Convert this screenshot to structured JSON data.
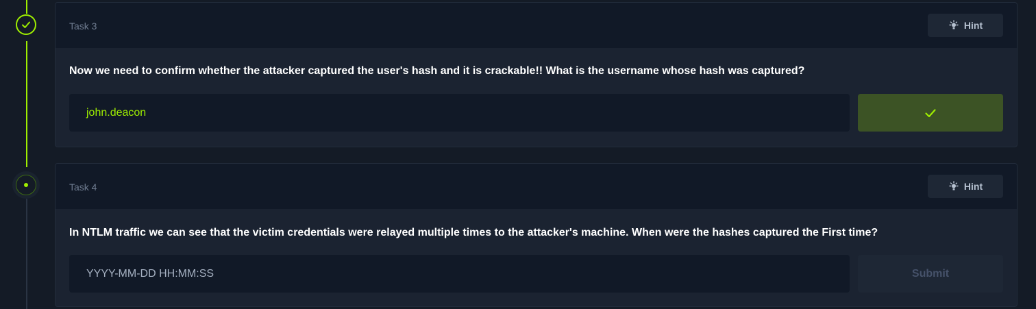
{
  "tasks": [
    {
      "label": "Task 3",
      "hint_label": "Hint",
      "question": "Now we need to confirm whether the attacker captured the user's hash and it is crackable!! What is the username whose hash was captured?",
      "answer": "john.deacon",
      "status": "completed",
      "button_icon": "check-icon"
    },
    {
      "label": "Task 4",
      "hint_label": "Hint",
      "question": "In NTLM traffic we can see that the victim credentials were relayed multiple times to the attacker's machine. When were the hashes captured the First time?",
      "answer_placeholder": "YYYY-MM-DD HH:MM:SS",
      "status": "current",
      "submit_label": "Submit"
    }
  ],
  "colors": {
    "accent": "#9fef00",
    "background": "#141b26",
    "card": "#1b2331",
    "card_header": "#111927",
    "correct_button": "#3c5325"
  }
}
